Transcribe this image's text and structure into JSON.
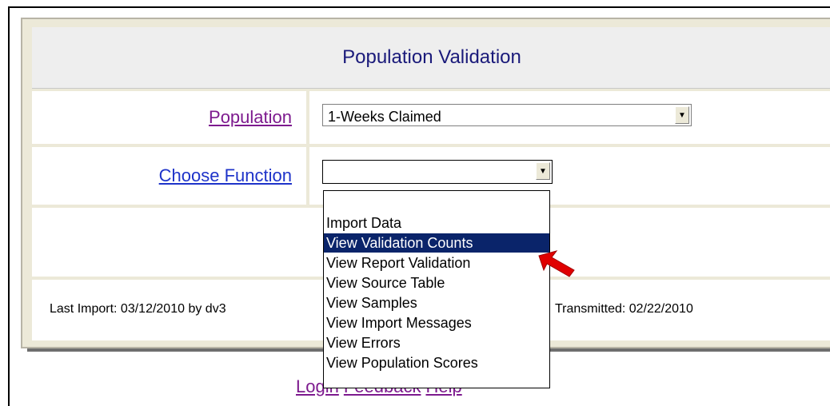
{
  "title": "Population Validation",
  "population": {
    "label": "Population",
    "selected": "1-Weeks Claimed"
  },
  "function": {
    "label": "Choose Function",
    "selected": "",
    "options": [
      "",
      "Import Data",
      "View Validation Counts",
      "View Report Validation",
      "View Source Table",
      "View Samples",
      "View Import Messages",
      "View Errors",
      "View Population Scores"
    ],
    "highlighted_index": 2
  },
  "status": {
    "last_import": "Last Import: 03/12/2010 by dv3",
    "transmitted": "Transmitted: 02/22/2010"
  },
  "footer": {
    "login": "Login",
    "feedback": "Feedback",
    "help": "Help"
  },
  "colors": {
    "title": "#1a1a7a",
    "visited_link": "#7d1a8e",
    "link": "#1e33c9",
    "selection": "#0a246a",
    "arrow": "#e00000"
  }
}
